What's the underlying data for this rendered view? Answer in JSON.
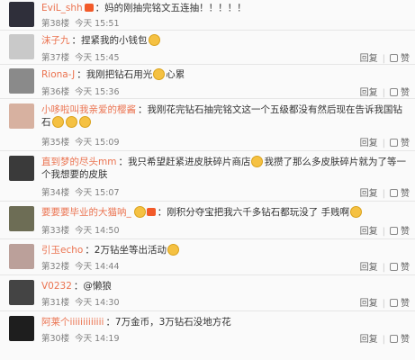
{
  "comments": [
    {
      "user": "EviL_shh",
      "vip": true,
      "text": "：妈的刚抽完铭文五连抽！！！！！",
      "emoji": 0,
      "floor": "第38楼",
      "time": "今天 15:51",
      "reply": "回复",
      "likes": "赞",
      "avatar": "#2f2f3a"
    },
    {
      "user": "沫子九",
      "vip": false,
      "text": "：捏紧我的小钱包",
      "emoji": 1,
      "floor": "第37楼",
      "time": "今天 15:45",
      "reply": "回复",
      "likes": "赞",
      "avatar": "#c9c9c9"
    },
    {
      "user": "Riona-J",
      "vip": false,
      "text": "：我刚把钻石用光",
      "text2": "心累",
      "emoji": 1,
      "floor": "第36楼",
      "time": "今天 15:36",
      "reply": "回复",
      "likes": "赞",
      "avatar": "#8a8a8a"
    },
    {
      "user": "小哆啦叫我亲爱的樱酱",
      "vip": false,
      "text": "：我刚花完钻石抽完铭文这一个五级都没有然后现在告诉我国钻石",
      "emoji": 3,
      "floor": "第35楼",
      "time": "今天 15:09",
      "reply": "回复",
      "likes": "赞",
      "avatar": "#d7b1a0"
    },
    {
      "user": "直到梦的尽头mm",
      "vip": false,
      "text": "：我只希望赶紧进皮肤碎片商店",
      "text2": "我攒了那么多皮肤碎片就为了等一个我想要的皮肤",
      "emoji": 1,
      "floor": "第34楼",
      "time": "今天 15:07",
      "reply": "回复",
      "likes": "赞",
      "avatar": "#3a3a3a"
    },
    {
      "user": "要要要毕业的大猫呐_",
      "vip": true,
      "text": "：刚积分夺宝把我六千多钻石都玩没了 手贱啊",
      "emoji": 2,
      "floor": "第33楼",
      "time": "今天 14:50",
      "reply": "回复",
      "likes": "赞",
      "avatar": "#6d6d55"
    },
    {
      "user": "引玉echo",
      "vip": false,
      "text": "：2万钻坐等出活动",
      "emoji": 1,
      "floor": "第32楼",
      "time": "今天 14:44",
      "reply": "回复",
      "likes": "赞",
      "avatar": "#bba09a"
    },
    {
      "user": "V0232",
      "vip": false,
      "text": "：@懒狼",
      "emoji": 0,
      "floor": "第31楼",
      "time": "今天 14:30",
      "reply": "回复",
      "likes": "赞",
      "avatar": "#444444"
    },
    {
      "user": "阿莱个iiiiiiiiiiiii",
      "vip": false,
      "text": "：7万金币，3万钻石没地方花",
      "emoji": 0,
      "floor": "第30楼",
      "time": "今天 14:19",
      "reply": "回复",
      "likes": "赞",
      "avatar": "#1e1e1e"
    }
  ]
}
